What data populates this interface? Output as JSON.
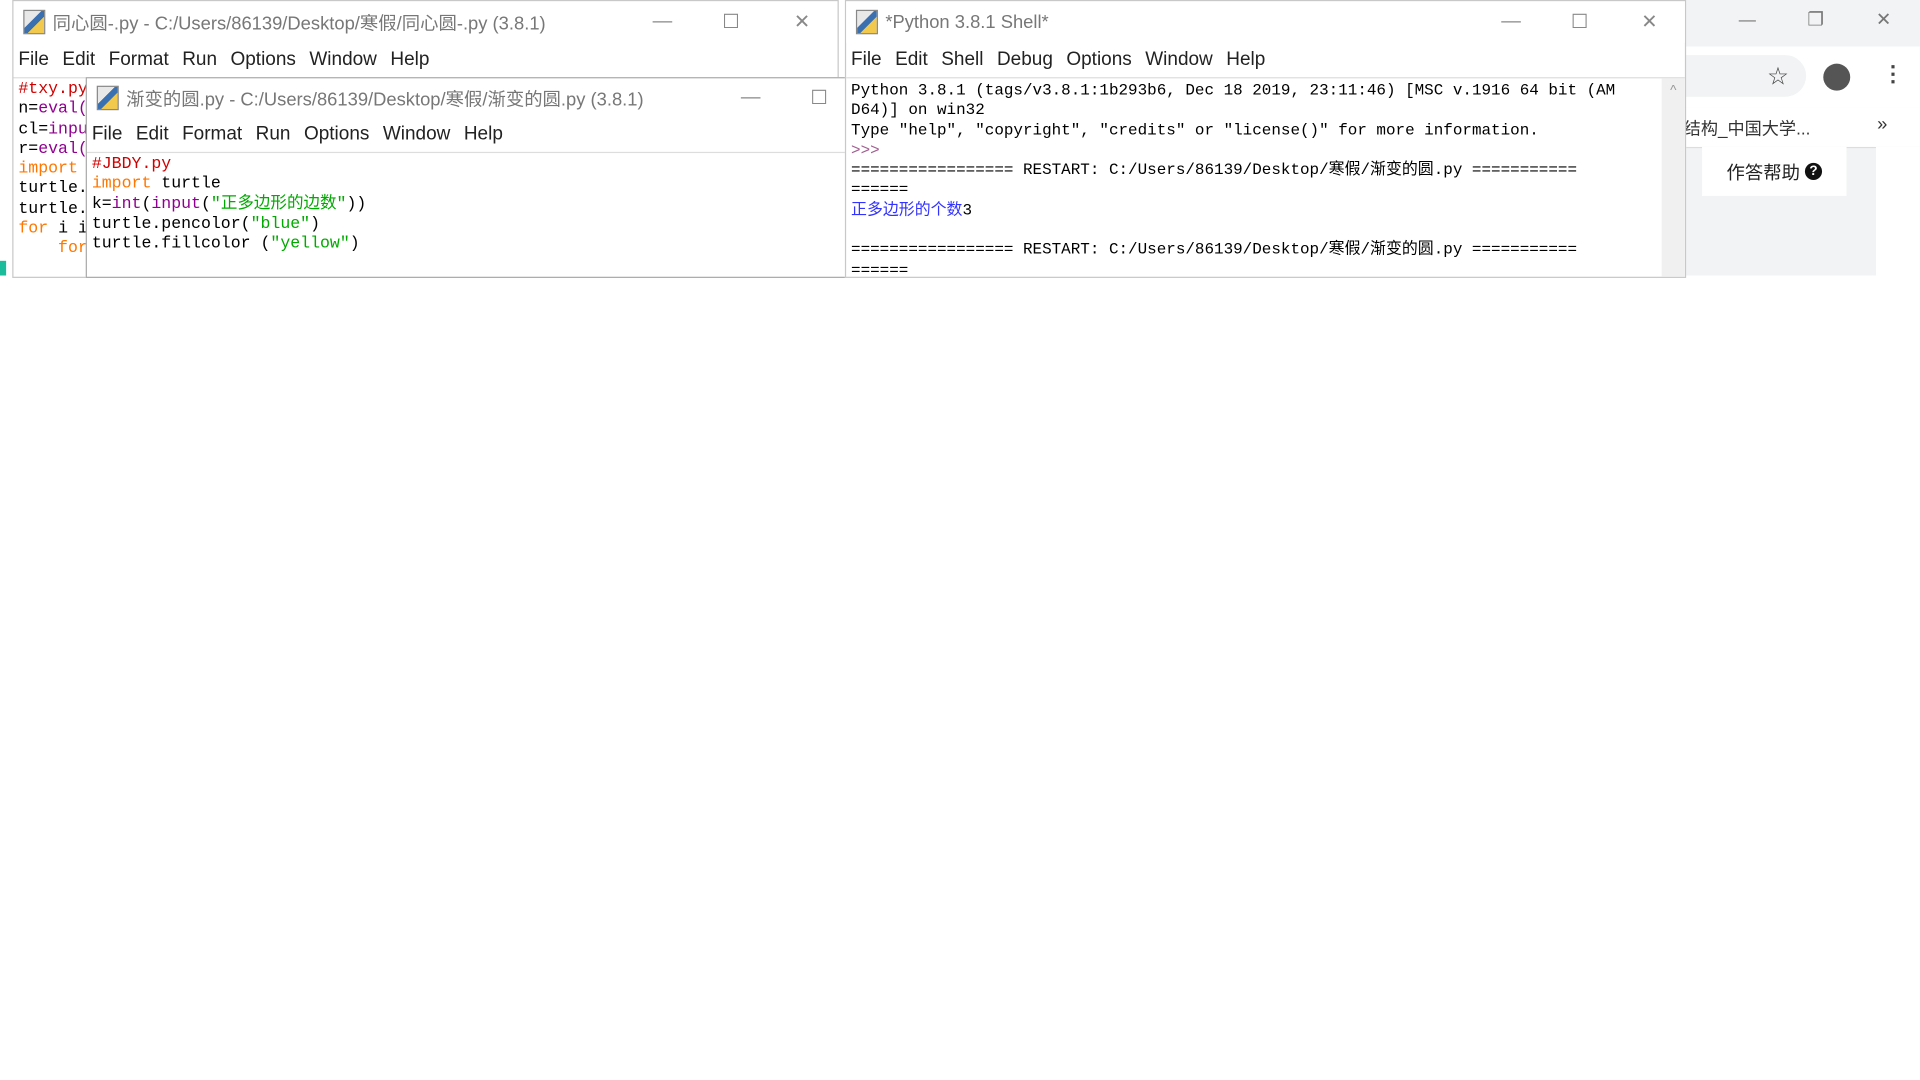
{
  "win1": {
    "title": "同心圆-.py - C:/Users/86139/Desktop/寒假/同心圆-.py (3.8.1)",
    "menu": [
      "File",
      "Edit",
      "Format",
      "Run",
      "Options",
      "Window",
      "Help"
    ],
    "lines": [
      [
        "cm",
        "#txy.py"
      ],
      [
        "",
        "n="
      ],
      [
        "bi",
        "eval("
      ],
      [
        "",
        "cl="
      ],
      [
        "bi",
        "inpu"
      ],
      [
        "",
        "r="
      ],
      [
        "bi",
        "eval("
      ],
      [
        "kw",
        "import"
      ],
      [
        "",
        "turtle."
      ],
      [
        "",
        "turtle."
      ],
      [
        "kw",
        "for"
      ],
      [
        "",
        "i i"
      ],
      [
        "kw",
        "    for"
      ]
    ]
  },
  "win2": {
    "title": "渐变的圆.py - C:/Users/86139/Desktop/寒假/渐变的圆.py (3.8.1)",
    "menu": [
      "File",
      "Edit",
      "Format",
      "Run",
      "Options",
      "Window",
      "Help"
    ],
    "code": {
      "l1": "#JBDY.py",
      "l2a": "import",
      "l2b": " turtle",
      "l3a": "k=",
      "l3b": "int",
      "l3c": "(",
      "l3d": "input",
      "l3e": "(",
      "l3f": "\"正多边形的边数\"",
      "l3g": "))",
      "l4a": "turtle.pencolor(",
      "l4b": "\"blue\"",
      "l4c": ")",
      "l5a": "turtle.fillcolor (",
      "l5b": "\"yellow\"",
      "l5c": ")"
    }
  },
  "shell": {
    "title": "*Python 3.8.1 Shell*",
    "menu": [
      "File",
      "Edit",
      "Shell",
      "Debug",
      "Options",
      "Window",
      "Help"
    ],
    "banner1": "Python 3.8.1 (tags/v3.8.1:1b293b6, Dec 18 2019, 23:11:46) [MSC v.1916 64 bit (AM",
    "banner2": "D64)] on win32",
    "banner3": "Type \"help\", \"copyright\", \"credits\" or \"license()\" for more information.",
    "prompt": ">>> ",
    "restart1": "================= RESTART: C:/Users/86139/Desktop/寒假/渐变的圆.py ===========",
    "restart1b": "======",
    "output": "正多边形的个数",
    "input": "3",
    "restart2": "================= RESTART: C:/Users/86139/Desktop/寒假/渐变的圆.py ===========",
    "restart2b": "======"
  },
  "browser": {
    "bookmark": "结构_中国大学...",
    "more": "»",
    "help_button": "作答帮助"
  },
  "controls": {
    "minimize": "—",
    "maximize": "☐",
    "close": "✕",
    "restore": "❐"
  }
}
